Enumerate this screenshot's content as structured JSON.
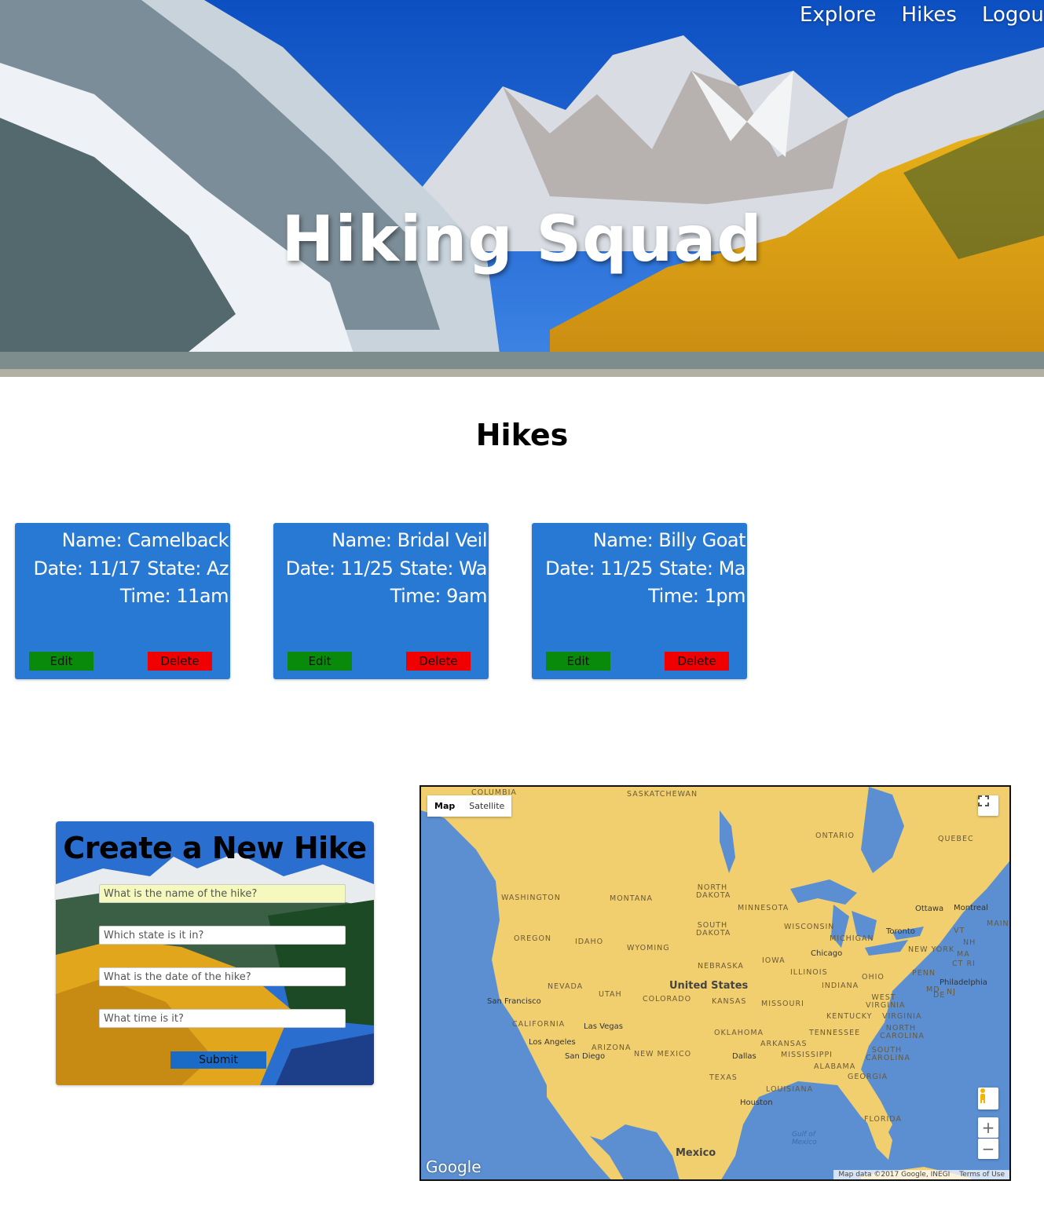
{
  "nav": {
    "items": [
      "Explore",
      "Hikes",
      "Logout"
    ]
  },
  "hero": {
    "title": "Hiking Squad"
  },
  "hikes_section": {
    "title": "Hikes"
  },
  "hikes": [
    {
      "name": "Name: Camelback",
      "date": "Date: 11/17",
      "state": "State: Az",
      "time": "Time: 11am",
      "edit_label": "Edit",
      "delete_label": "Delete"
    },
    {
      "name": "Name: Bridal Veil",
      "date": "Date: 11/25",
      "state": "State: Wa",
      "time": "Time: 9am",
      "edit_label": "Edit",
      "delete_label": "Delete"
    },
    {
      "name": "Name: Billy Goat",
      "date": "Date: 11/25",
      "state": "State: Ma",
      "time": "Time: 1pm",
      "edit_label": "Edit",
      "delete_label": "Delete"
    }
  ],
  "form": {
    "title": "Create a New Hike",
    "name_placeholder": "What is the name of the hike?",
    "state_placeholder": "Which state is it in?",
    "date_placeholder": "What is the date of the hike?",
    "time_placeholder": "What time is it?",
    "submit_label": "Submit"
  },
  "map": {
    "type_map": "Map",
    "type_satellite": "Satellite",
    "zoom_in": "+",
    "zoom_out": "−",
    "logo": "Google",
    "attribution": "Map data ©2017 Google, INEGI",
    "terms": "Terms of Use",
    "country_label": "United States",
    "mexico_label": "Mexico",
    "gulf_label": "Gulf of Mexico",
    "regions": [
      "COLUMBIA",
      "SASKATCHEWAN",
      "ONTARIO",
      "QUEBEC",
      "WASHINGTON",
      "MONTANA",
      "NORTH DAKOTA",
      "MINNESOTA",
      "OREGON",
      "IDAHO",
      "WYOMING",
      "SOUTH DAKOTA",
      "WISCONSIN",
      "MICHIGAN",
      "NEBRASKA",
      "IOWA",
      "ILLINOIS",
      "INDIANA",
      "OHIO",
      "PENN",
      "NEW YORK",
      "NEVADA",
      "UTAH",
      "COLORADO",
      "KANSAS",
      "MISSOURI",
      "KENTUCKY",
      "VIRGINIA",
      "WEST VIRGINIA",
      "CALIFORNIA",
      "ARIZONA",
      "NEW MEXICO",
      "OKLAHOMA",
      "ARKANSAS",
      "TENNESSEE",
      "NORTH CAROLINA",
      "SOUTH CAROLINA",
      "MISSISSIPPI",
      "ALABAMA",
      "GEORGIA",
      "TEXAS",
      "LOUISIANA",
      "FLORIDA",
      "MAINE",
      "VT",
      "NH",
      "MA",
      "CT RI",
      "MD",
      "DE",
      "NJ"
    ],
    "cities": [
      "Ottawa",
      "Montreal",
      "Toronto",
      "Chicago",
      "Philadelphia",
      "San Francisco",
      "Las Vegas",
      "Los Angeles",
      "San Diego",
      "Dallas",
      "Houston"
    ],
    "colors": {
      "water": "#5b8fd1",
      "land": "#f2cf6e"
    }
  },
  "colors": {
    "card": "#2879d3",
    "edit": "#0a8a0a",
    "delete": "#f00000",
    "submit": "#1a6bc7"
  }
}
